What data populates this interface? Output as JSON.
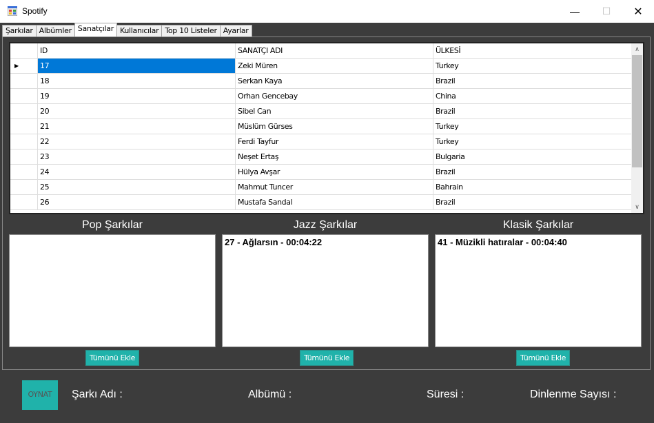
{
  "window": {
    "title": "Spotify",
    "minimize": "—",
    "maximize": "☐",
    "close": "✕"
  },
  "tabs": [
    {
      "label": "Şarkılar",
      "active": false
    },
    {
      "label": "Albümler",
      "active": false
    },
    {
      "label": "Sanatçılar",
      "active": true
    },
    {
      "label": "Kullanıcılar",
      "active": false
    },
    {
      "label": "Top 10 Listeler",
      "active": false
    },
    {
      "label": "Ayarlar",
      "active": false
    }
  ],
  "grid": {
    "columns": [
      "ID",
      "SANATÇI ADI",
      "ÜLKESİ"
    ],
    "selected_row_marker": "▶",
    "rows": [
      {
        "id": "17",
        "name": "Zeki Müren",
        "country": "Turkey"
      },
      {
        "id": "18",
        "name": "Serkan Kaya",
        "country": "Brazil"
      },
      {
        "id": "19",
        "name": "Orhan Gencebay",
        "country": "China"
      },
      {
        "id": "20",
        "name": "Sibel Can",
        "country": "Brazil"
      },
      {
        "id": "21",
        "name": "Müslüm Gürses",
        "country": "Turkey"
      },
      {
        "id": "22",
        "name": "Ferdi Tayfur",
        "country": "Turkey"
      },
      {
        "id": "23",
        "name": "Neşet Ertaş",
        "country": "Bulgaria"
      },
      {
        "id": "24",
        "name": "Hülya Avşar",
        "country": "Brazil"
      },
      {
        "id": "25",
        "name": "Mahmut Tuncer",
        "country": "Bahrain"
      },
      {
        "id": "26",
        "name": "Mustafa Sandal",
        "country": "Brazil"
      }
    ],
    "scroll_up": "∧",
    "scroll_down": "∨"
  },
  "genres": {
    "pop": {
      "title": "Pop Şarkılar",
      "items": [],
      "button": "Tümünü Ekle"
    },
    "jazz": {
      "title": "Jazz Şarkılar",
      "items": [
        "27 - Ağlarsın - 00:04:22"
      ],
      "button": "Tümünü Ekle"
    },
    "classic": {
      "title": "Klasik Şarkılar",
      "items": [
        "41 - Müzikli hatıralar - 00:04:40"
      ],
      "button": "Tümünü Ekle"
    }
  },
  "player": {
    "play_label": "OYNAT",
    "song_name_label": "Şarkı Adı :",
    "album_label": "Albümü :",
    "duration_label": "Süresi :",
    "listen_count_label": "Dinlenme Sayısı :"
  },
  "colors": {
    "accent": "#20b2aa",
    "background": "#3c3c3c",
    "selection": "#0078d7"
  }
}
